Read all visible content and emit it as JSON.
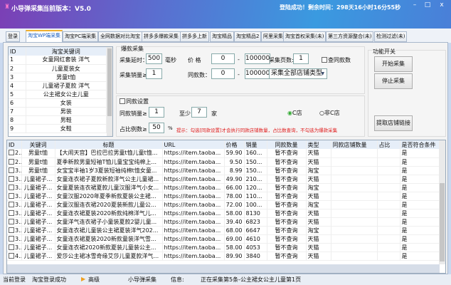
{
  "app": {
    "title": "小导弹采集",
    "version": "当前版本：V5.0",
    "login_status": "登陆成功！剩余时间：298天16小时16分55秒",
    "icon": "app-logo-icon"
  },
  "window_controls": {
    "minimize": "–",
    "maximize": "□",
    "close": "x"
  },
  "tabs": [
    "登录",
    "淘宝WP端采集",
    "淘宝PC端采集",
    "全网数据对比淘宝",
    "拼多多爆款采集",
    "拼多多上新",
    "淘宝精品",
    "淘宝精品2",
    "阿里采集",
    "淘宝首权采集(未)",
    "第三方资源整合(未)",
    "检测过滤(未)"
  ],
  "active_tab": 1,
  "keywords": {
    "headers": [
      "ID",
      "淘宝关键词"
    ],
    "rows": [
      [
        "1",
        "女童网红套装 洋气"
      ],
      [
        "2",
        "儿童夏装女"
      ],
      [
        "3",
        "男童t恤"
      ],
      [
        "4",
        "儿童裙子夏款 洋气"
      ],
      [
        "5",
        "公主裙女公主儿童"
      ],
      [
        "6",
        "女装"
      ],
      [
        "7",
        "男装"
      ],
      [
        "8",
        "男鞋"
      ],
      [
        "9",
        "女鞋"
      ]
    ]
  },
  "hot_collect": {
    "title": "爆款采集",
    "delay_label": "采集延时：",
    "delay_value": "500",
    "delay_unit": "毫秒",
    "price_label": "价 格",
    "price_min": "0",
    "price_max": "100000",
    "dash": "-",
    "pages_label": "采集页数:",
    "pages_value": "1",
    "query_same_label": "查同款数",
    "sales_label": "采集销量≥",
    "sales_value": "1",
    "same_count_label": "同款数：",
    "same_min": "0",
    "same_max": "100000",
    "shop_type_selected": "采集全部店铺类型"
  },
  "same_settings": {
    "title": "同款设置",
    "sales_label": "同款销量≥",
    "sales_value": "1",
    "atleast_label": "至少",
    "atleast_value": "7",
    "atleast_unit": "家",
    "radio_c": "C店",
    "radio_non_c": "非C店",
    "ratio_label": "占比例数≥",
    "ratio_value": "50",
    "ratio_unit": "%",
    "hint": "提示：勾选[同款设置]才会执行同款店铺数量，占比数查询，不勾选为爆款采集",
    "hint_color": "#e02020"
  },
  "functions": {
    "title": "功能开关",
    "start": "开始采集",
    "stop": "停止采集",
    "extract": "提取店铺链接"
  },
  "results": {
    "headers": [
      "ID",
      "关键词",
      "标题",
      "URL",
      "价格",
      "销量",
      "同款数量",
      "类型",
      "同款店铺数量",
      "占比",
      "是否符合条件"
    ],
    "rows": [
      [
        "2..",
        "男童t恤",
        "【大闹天宫】巴拉巴拉男童t恤儿童t恤...",
        "https://item.taoba...",
        "59.90",
        "160...",
        "暂不查询",
        "天猫",
        "",
        "",
        "是"
      ],
      [
        "2..",
        "男童t恤",
        "夏季新款男童短袖T恤儿童宝宝纯棉上...",
        "https://item.taoba...",
        "9.50",
        "150...",
        "暂不查询",
        "天猫",
        "",
        "",
        "是"
      ],
      [
        "3..",
        "男童t恤",
        "女宝宝半袖1岁3夏装短袖纯棉t恤女童...",
        "https://item.taoba...",
        "8.99",
        "150...",
        "暂不查询",
        "淘宝",
        "",
        "",
        "是"
      ],
      [
        "3..",
        "儿童裙子...",
        "女童连衣裙子夏款新款洋气公主儿童裙...",
        "https://item.taoba...",
        "49.90",
        "210...",
        "暂不查询",
        "天猫",
        "",
        "",
        "是"
      ],
      [
        "3..",
        "儿童裙子...",
        "女童夏装连衣裙夏款儿童汉服洋气小女...",
        "https://item.taoba...",
        "66.00",
        "120...",
        "暂不查询",
        "淘宝",
        "",
        "",
        "是"
      ],
      [
        "3..",
        "儿童裙子...",
        "女童汉服2020年夏季新款夏装公主裙...",
        "https://item.taoba...",
        "78.00",
        "110...",
        "暂不查询",
        "天猫",
        "",
        "",
        "是"
      ],
      [
        "3..",
        "儿童裙子...",
        "女童汉服连衣裙2020夏装新款儿童公...",
        "https://item.taoba...",
        "72.00",
        "100...",
        "暂不查询",
        "淘宝",
        "",
        "",
        "是"
      ],
      [
        "3..",
        "儿童裙子...",
        "女童连衣裙夏装2020新款纯棉洋气儿...",
        "https://item.taoba...",
        "58.00",
        "8130",
        "暂不查询",
        "天猫",
        "",
        "",
        "是"
      ],
      [
        "3..",
        "儿童裙子...",
        "女童洋气连衣裙子小童装夏款2婴儿童...",
        "https://item.taoba...",
        "39.40",
        "6823",
        "暂不查询",
        "天猫",
        "",
        "",
        "是"
      ],
      [
        "3..",
        "儿童裙子...",
        "女童连衣裙儿童装公主裙夏装洋气202...",
        "https://item.taoba...",
        "68.00",
        "6647",
        "暂不查询",
        "淘宝",
        "",
        "",
        "是"
      ],
      [
        "3..",
        "儿童裙子...",
        "女童连衣裙夏装2020新款童装洋气雪...",
        "https://item.taoba...",
        "69.00",
        "4610",
        "暂不查询",
        "天猫",
        "",
        "",
        "是"
      ],
      [
        "3..",
        "儿童裙子...",
        "女童连衣裙2020新款夏装儿童装公主...",
        "https://item.taoba...",
        "58.00",
        "4053",
        "暂不查询",
        "天猫",
        "",
        "",
        "是"
      ],
      [
        "4..",
        "儿童裙子...",
        "爱莎公主裙冰雪奇缘艾莎儿童夏款洋气...",
        "https://item.taoba...",
        "89.90",
        "3840",
        "暂不查询",
        "天猫",
        "",
        "",
        "是"
      ]
    ]
  },
  "status": {
    "current_login": "当前登录",
    "login_result": "淘宝登录成功",
    "arrow_icon": "play-arrow-icon",
    "level": "高级",
    "brand": "小导弹采集",
    "info_label": "信息:",
    "info": "正在采集第5条-公主裙女公主儿童第1页"
  }
}
